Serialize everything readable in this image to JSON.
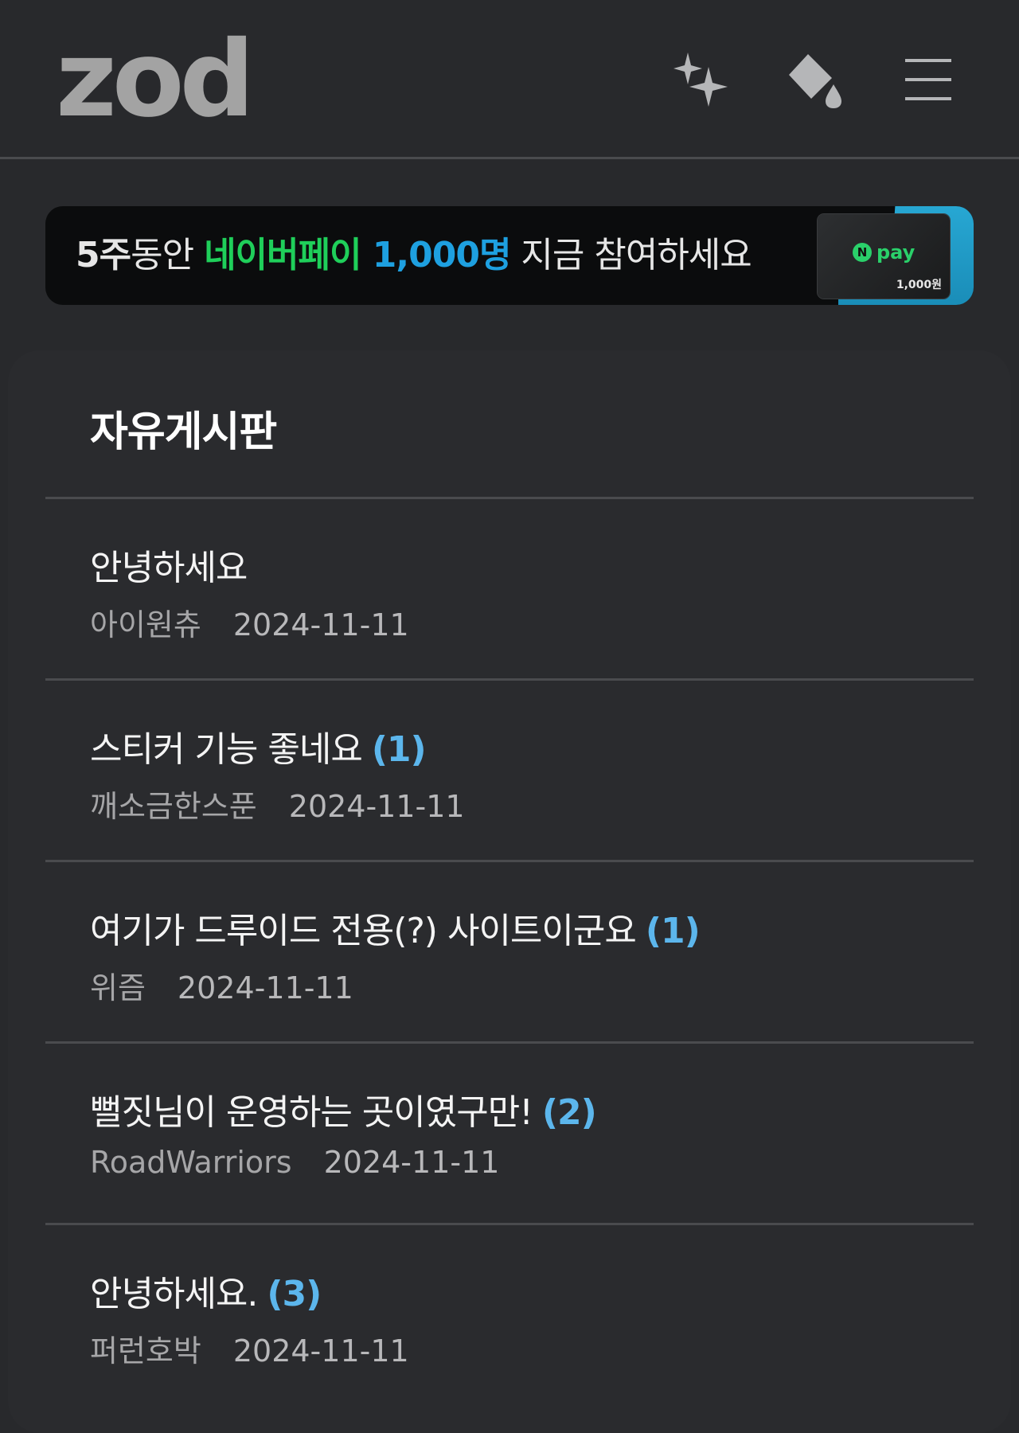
{
  "header": {
    "logo": "zod",
    "icons": [
      "sparkle-icon",
      "paint-bucket-icon",
      "menu-icon"
    ]
  },
  "banner": {
    "part1": "5주",
    "part2": "동안 ",
    "part3": "네이버페이 ",
    "part4": "1,000명",
    "part5": " 지금 참여하세요",
    "card_brand": "pay",
    "card_brand_n": "N",
    "card_amount": "1,000원"
  },
  "board": {
    "title": "자유게시판",
    "posts": [
      {
        "title": "안녕하세요",
        "comments": "",
        "author": "아이원츄",
        "date": "2024-11-11"
      },
      {
        "title": "스티커 기능 좋네요",
        "comments": "(1)",
        "author": "깨소금한스푼",
        "date": "2024-11-11"
      },
      {
        "title": "여기가 드루이드 전용(?) 사이트이군요",
        "comments": "(1)",
        "author": "위즘",
        "date": "2024-11-11"
      },
      {
        "title": "뻘짓님이 운영하는 곳이였구만!",
        "comments": "(2)",
        "author": "RoadWarriors",
        "date": "2024-11-11"
      },
      {
        "title": "안녕하세요.",
        "comments": "(3)",
        "author": "퍼런호박",
        "date": "2024-11-11"
      }
    ]
  },
  "colors": {
    "background": "#28292c",
    "accent_blue": "#5cb6ec",
    "banner_green": "#1fcf5a",
    "banner_blue": "#1ea0e0"
  }
}
